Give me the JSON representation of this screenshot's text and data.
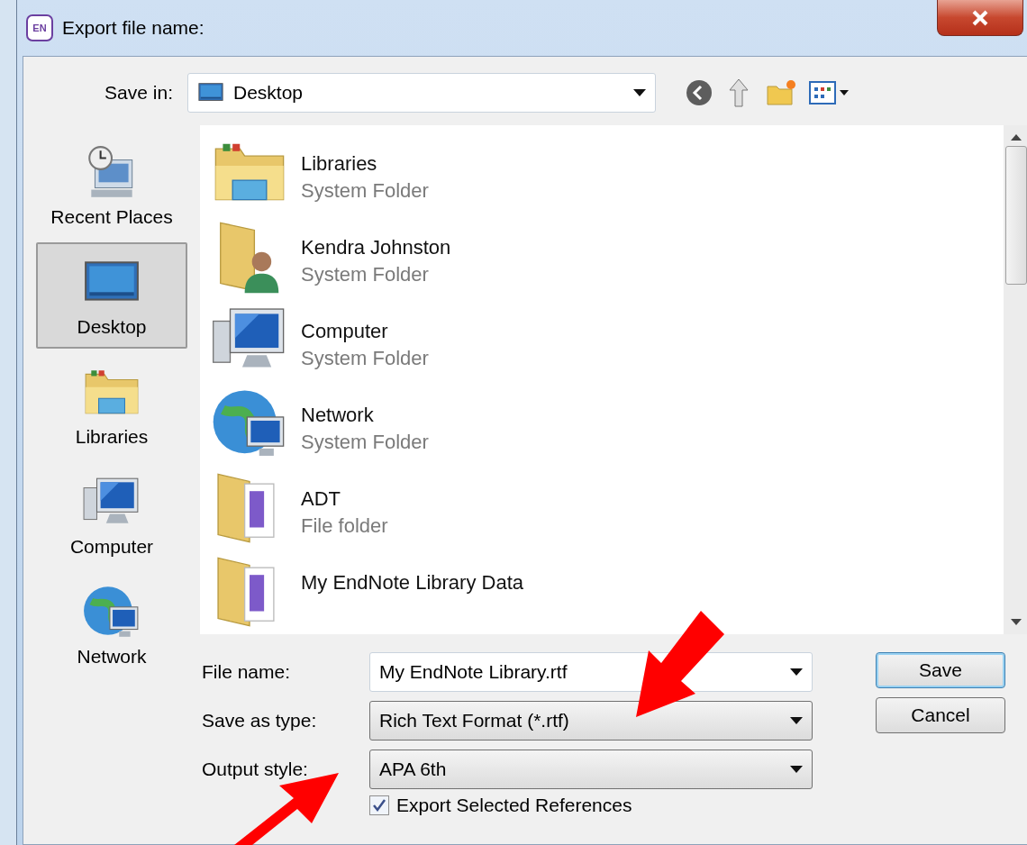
{
  "window": {
    "badge": "EN",
    "title": "Export file name:"
  },
  "save_in": {
    "label": "Save in:",
    "value": "Desktop"
  },
  "places": [
    {
      "label": "Recent Places",
      "kind": "recent",
      "selected": false
    },
    {
      "label": "Desktop",
      "kind": "desktop",
      "selected": true
    },
    {
      "label": "Libraries",
      "kind": "libraries",
      "selected": false
    },
    {
      "label": "Computer",
      "kind": "computer",
      "selected": false
    },
    {
      "label": "Network",
      "kind": "network",
      "selected": false
    }
  ],
  "files": [
    {
      "name": "Libraries",
      "type": "System Folder",
      "kind": "libraries"
    },
    {
      "name": "Kendra Johnston",
      "type": "System Folder",
      "kind": "user"
    },
    {
      "name": "Computer",
      "type": "System Folder",
      "kind": "computer"
    },
    {
      "name": "Network",
      "type": "System Folder",
      "kind": "network"
    },
    {
      "name": "ADT",
      "type": "File folder",
      "kind": "folder"
    },
    {
      "name": "My EndNote Library Data",
      "kind": "folder"
    }
  ],
  "fields": [
    {
      "label": "File name:",
      "value": "My EndNote Library.rtf",
      "kind": "edit"
    },
    {
      "label": "Save as type:",
      "value": "Rich Text Format (*.rtf)",
      "kind": "list"
    },
    {
      "label": "Output style:",
      "value": "APA 6th",
      "kind": "list"
    }
  ],
  "export_selected": {
    "label": "Export Selected References",
    "checked": true
  },
  "buttons": [
    {
      "label": "Save",
      "kind": "default"
    },
    {
      "label": "Cancel",
      "kind": "normal"
    }
  ]
}
